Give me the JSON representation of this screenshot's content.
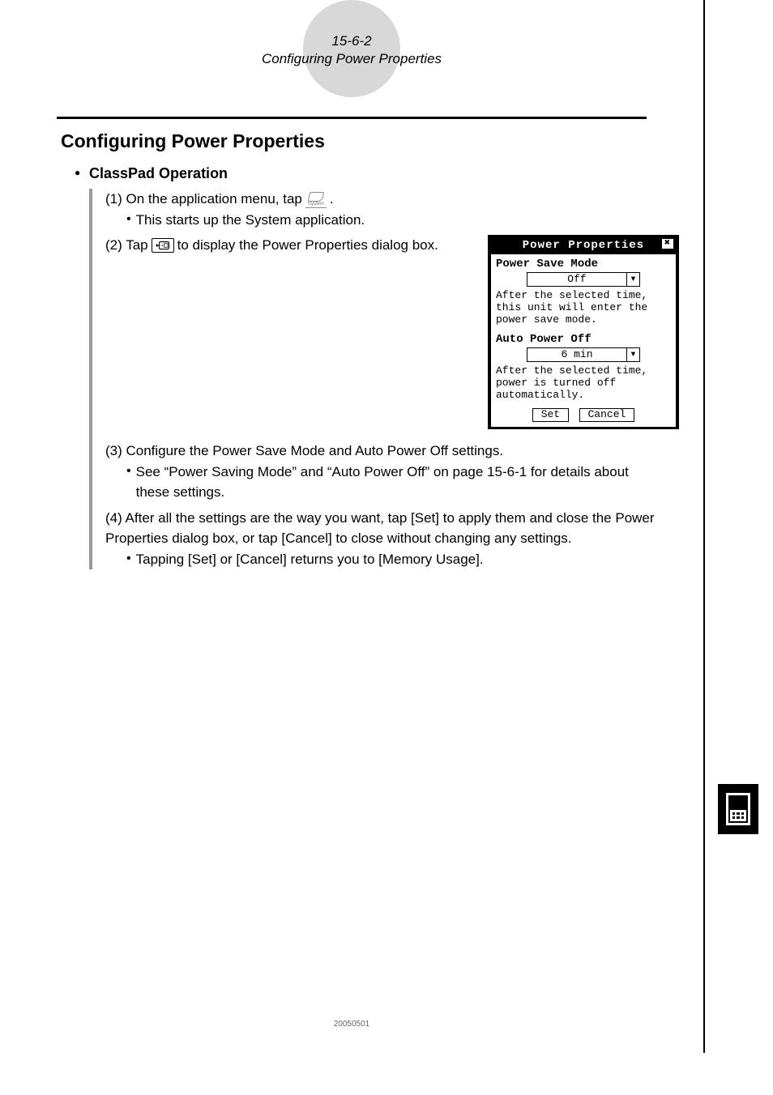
{
  "header": {
    "page_code": "15-6-2",
    "page_title": "Configuring Power Properties"
  },
  "section": {
    "title": "Configuring Power Properties",
    "subhead": "ClassPad Operation"
  },
  "steps": {
    "s1_prefix": "(1) On the application menu, tap",
    "s1_suffix": ".",
    "s1_icon_label": "System",
    "s1_sub": "This starts up the System application.",
    "s2_prefix": "(2) Tap",
    "s2_suffix": "to display the Power Properties dialog box.",
    "s3": "(3) Configure the Power Save Mode and Auto Power Off settings.",
    "s3_sub": "See “Power Saving Mode” and “Auto Power Off” on page 15-6-1 for details about these settings.",
    "s4": "(4) After all the settings are the way you want, tap [Set] to apply them and close the Power Properties dialog box, or tap [Cancel] to close without changing any settings.",
    "s4_sub": "Tapping [Set] or [Cancel] returns you to [Memory Usage]."
  },
  "dialog": {
    "title": "Power Properties",
    "section1_label": "Power Save Mode",
    "section1_value": "Off",
    "section1_note": "After the selected time, this unit will enter the power save mode.",
    "section2_label": "Auto Power Off",
    "section2_value": "6 min",
    "section2_note": "After the selected time, power is turned off automatically.",
    "btn_set": "Set",
    "btn_cancel": "Cancel"
  },
  "footer": {
    "code": "20050501"
  }
}
